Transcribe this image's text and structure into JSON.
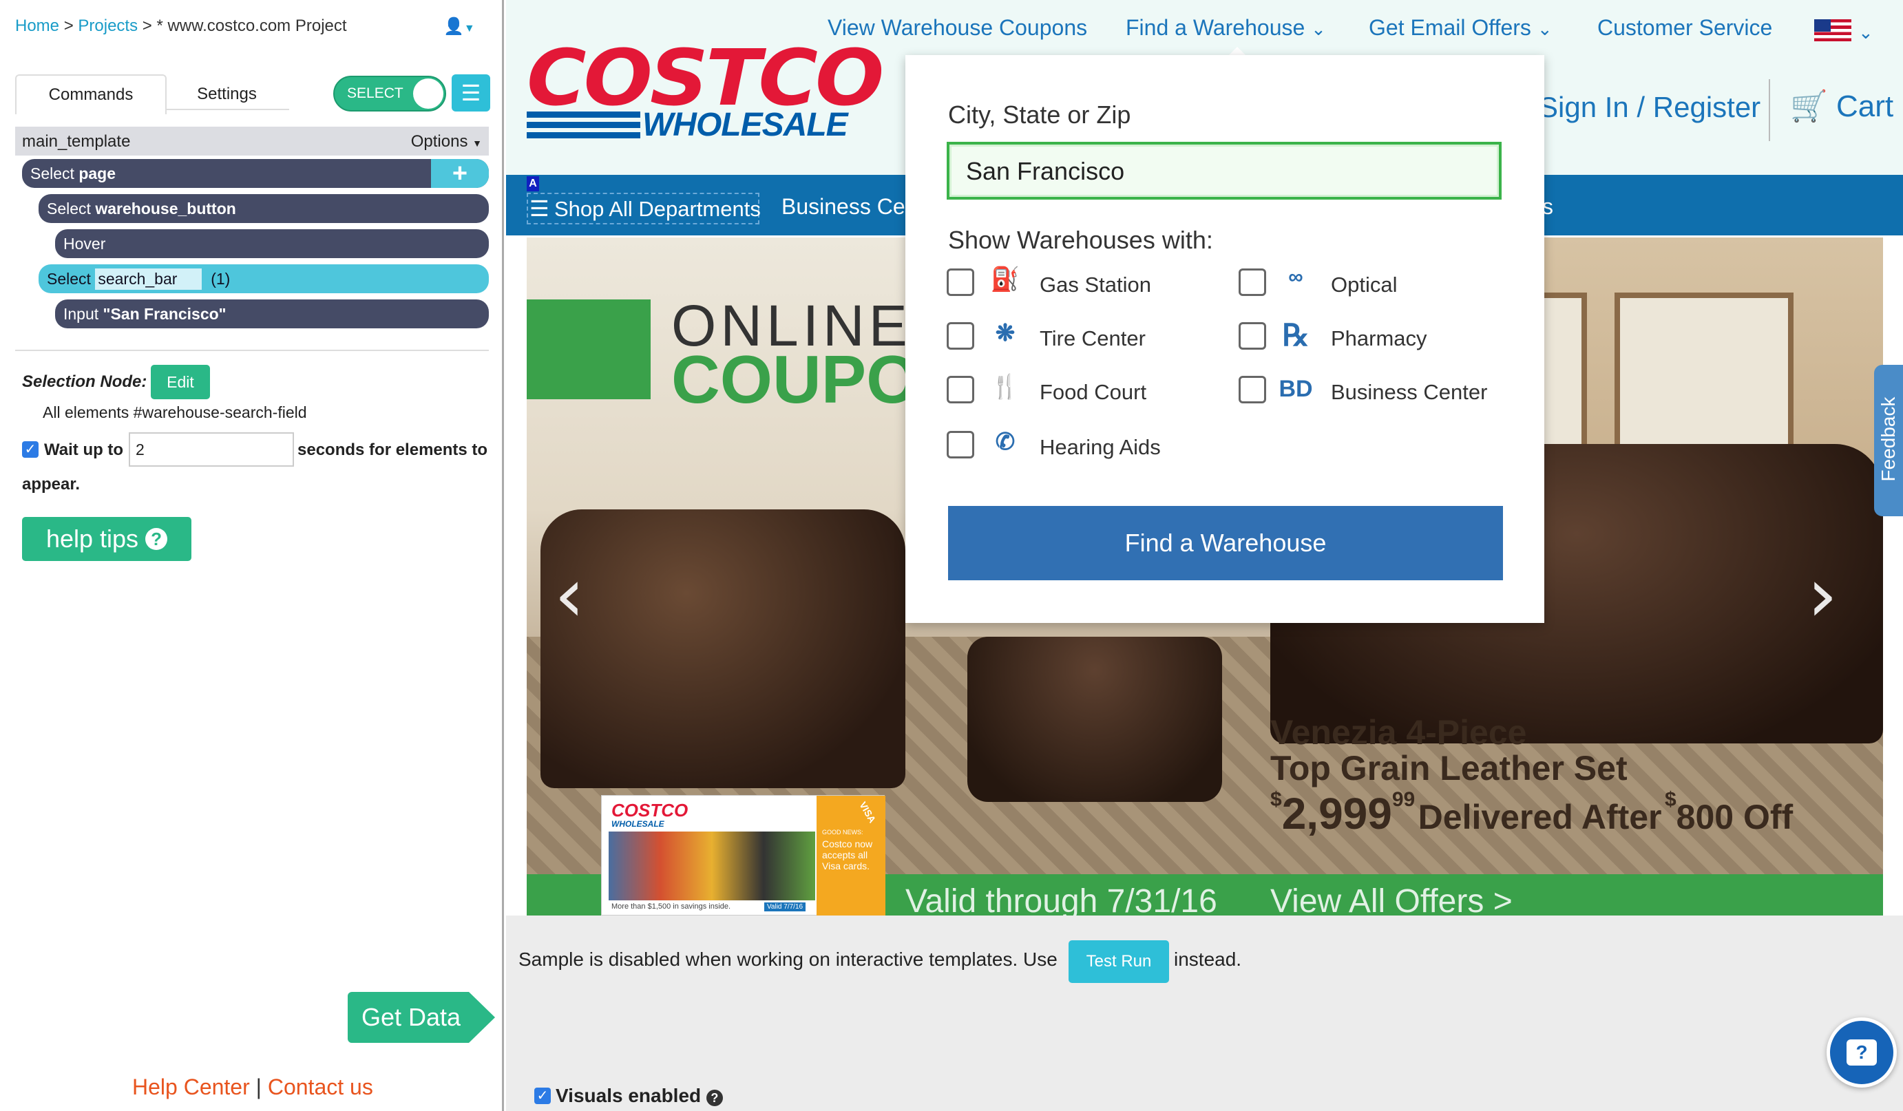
{
  "tool": {
    "breadcrumb": {
      "home": "Home",
      "sep1": ">",
      "projects": "Projects",
      "sep2": ">",
      "project": "* www.costco.com Project"
    },
    "tabs": {
      "commands": "Commands",
      "settings": "Settings"
    },
    "select_toggle": "SELECT",
    "template": {
      "name": "main_template",
      "options": "Options"
    },
    "commands": [
      {
        "verb": "Select",
        "target": "page"
      },
      {
        "verb": "Select",
        "target": "warehouse_button"
      },
      {
        "verb": "Hover",
        "target": ""
      },
      {
        "verb": "Select",
        "target": "search_bar",
        "count": "(1)"
      },
      {
        "verb": "Input",
        "target": "\"San Francisco\""
      }
    ],
    "selection_node": {
      "label": "Selection Node:",
      "edit": "Edit",
      "desc": "All elements #warehouse-search-field"
    },
    "wait": {
      "prefix": "Wait up to",
      "value": "2",
      "suffix": "seconds for elements to",
      "suffix2": "appear."
    },
    "help_tips": "help tips",
    "get_data": "Get Data",
    "help_center": "Help Center",
    "divider": "|",
    "contact_us": "Contact us",
    "sample_msg": "Sample is disabled when working on interactive templates. Use",
    "test_run": "Test Run",
    "sample_msg_end": "instead.",
    "visuals": "Visuals enabled"
  },
  "site": {
    "logo_top": "COSTCO",
    "logo_bottom": "WHOLESALE",
    "top_links": [
      "View Warehouse Coupons",
      "Find a Warehouse",
      "Get Email Offers",
      "Customer Service"
    ],
    "sign_in": "Sign In / Register",
    "cart": "Cart",
    "nav": {
      "shop_all": "Shop All Departments",
      "business": "Business Cen",
      "tail": "s"
    },
    "feedback": "Feedback",
    "banner": {
      "online": "ONLINE",
      "coupons": "COUPO",
      "product_line1": "Venezia 4-Piece",
      "product_line2": "Top Grain Leather Set",
      "price_sym": "$",
      "price": "2,999",
      "cents": "99",
      "delivered": "Delivered After",
      "off_sym": "$",
      "off": "800 Off",
      "valid": "Valid through 7/31/16",
      "view_all": "View All Offers >",
      "thumb_logo": "COSTCO",
      "thumb_logo2": "WHOLESALE",
      "thumb_visa": "VISA",
      "thumb_note": "Costco now accepts all Visa cards.",
      "thumb_good": "GOOD NEWS:",
      "thumb_bottom": "More than $1,500 in savings inside.",
      "thumb_valid": "Valid 7/7/16"
    },
    "dropdown": {
      "label": "City, State or Zip",
      "value": "San Francisco",
      "show_label": "Show Warehouses with:",
      "filters": [
        {
          "label": "Gas Station",
          "icon": "gas-pump-icon"
        },
        {
          "label": "Optical",
          "icon": "glasses-icon"
        },
        {
          "label": "Tire Center",
          "icon": "tire-icon"
        },
        {
          "label": "Pharmacy",
          "icon": "rx-icon"
        },
        {
          "label": "Food Court",
          "icon": "fork-knife-icon"
        },
        {
          "label": "Business Center",
          "icon": "bd-icon"
        },
        {
          "label": "Hearing Aids",
          "icon": "ear-icon"
        }
      ],
      "rx": "℞",
      "bd": "BD",
      "button": "Find a Warehouse"
    }
  },
  "colors": {
    "accent": "#4ec6dc",
    "green": "#2ab887",
    "costco_red": "#e31837",
    "costco_blue": "#005daa",
    "nav_blue": "#0f6fad",
    "button_blue": "#3170b3"
  }
}
